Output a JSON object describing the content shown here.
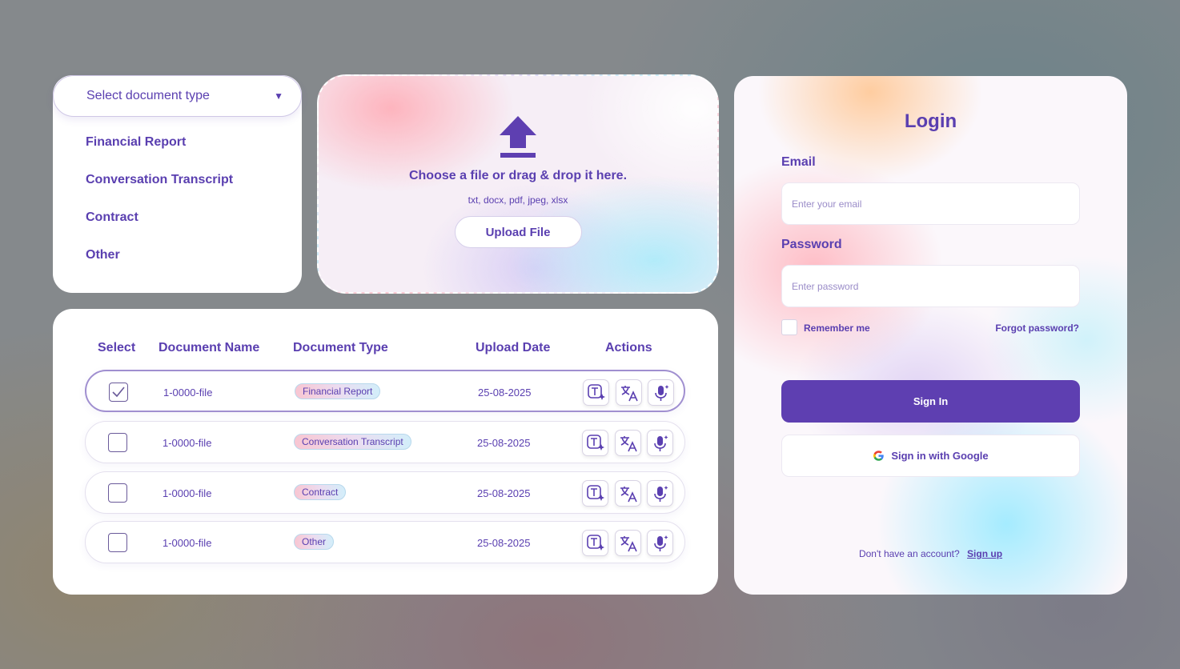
{
  "dropdown": {
    "placeholder": "Select document type",
    "options": [
      "Financial Report",
      "Conversation Transcript",
      "Contract",
      "Other"
    ]
  },
  "upload": {
    "title": "Choose a file or drag & drop it here.",
    "formats": "txt, docx, pdf, jpeg, xlsx",
    "button": "Upload File"
  },
  "table": {
    "headers": [
      "Select",
      "Document Name",
      "Document Type",
      "Upload Date",
      "Actions"
    ],
    "rows": [
      {
        "selected": true,
        "name": "1-0000-file",
        "type": "Financial Report",
        "date": "25-08-2025"
      },
      {
        "selected": false,
        "name": "1-0000-file",
        "type": "Conversation Transcript",
        "date": "25-08-2025"
      },
      {
        "selected": false,
        "name": "1-0000-file",
        "type": "Contract",
        "date": "25-08-2025"
      },
      {
        "selected": false,
        "name": "1-0000-file",
        "type": "Other",
        "date": "25-08-2025"
      }
    ],
    "actions": [
      "text-ai-icon",
      "translate-icon",
      "voice-ai-icon"
    ]
  },
  "login": {
    "title": "Login",
    "email_label": "Email",
    "email_placeholder": "Enter your email",
    "password_label": "Password",
    "password_placeholder": "Enter password",
    "remember": "Remember me",
    "forgot": "Forgot password?",
    "signin": "Sign In",
    "google": "Sign in with Google",
    "no_account": "Don't have an account?",
    "signup": "Sign up"
  },
  "colors": {
    "accent": "#5e3fb1",
    "text": "#5a3fb0"
  }
}
